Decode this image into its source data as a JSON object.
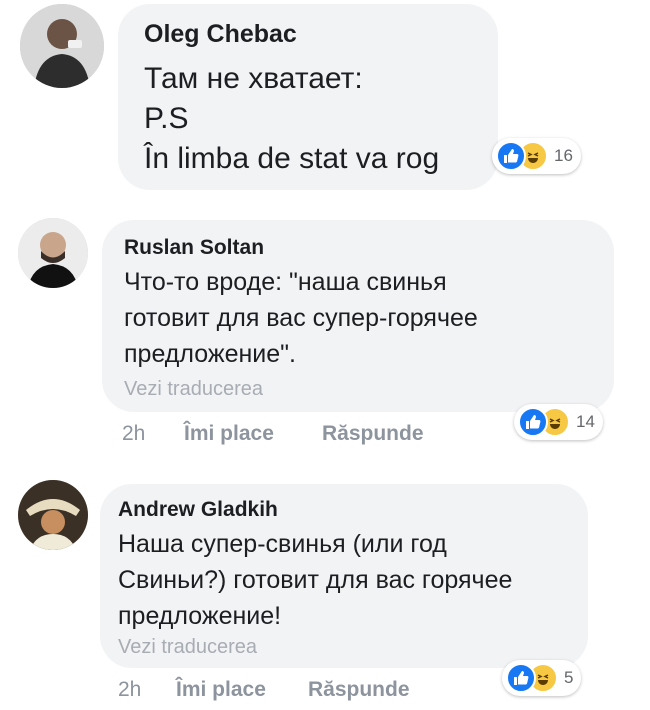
{
  "comments": [
    {
      "author": "Oleg Chebac",
      "lines": [
        "Там не хватает:",
        "P.S",
        "În limba de stat va rog"
      ],
      "reaction_count": "16"
    },
    {
      "author": "Ruslan Soltan",
      "lines": [
        "Что-то вроде: \"наша свинья",
        "готовит для вас супер-горячее",
        "предложение\"."
      ],
      "translate": "Vezi traducerea",
      "time": "2h",
      "like": "Îmi place",
      "reply": "Răspunde",
      "reaction_count": "14"
    },
    {
      "author": "Andrew Gladkih",
      "lines": [
        "Наша супер-свинья (или год",
        "Свиньи?) готовит для вас горячее",
        "предложение!"
      ],
      "translate": "Vezi traducerea",
      "time": "2h",
      "like": "Îmi place",
      "reply": "Răspunde",
      "reaction_count": "5"
    }
  ],
  "icons": {
    "like": "thumbs-up-icon",
    "haha": "laughing-face-icon"
  },
  "colors": {
    "like_blue": "#1877f2",
    "haha_yellow": "#f7c844",
    "bubble": "#f2f3f5",
    "meta": "#8d949e"
  }
}
